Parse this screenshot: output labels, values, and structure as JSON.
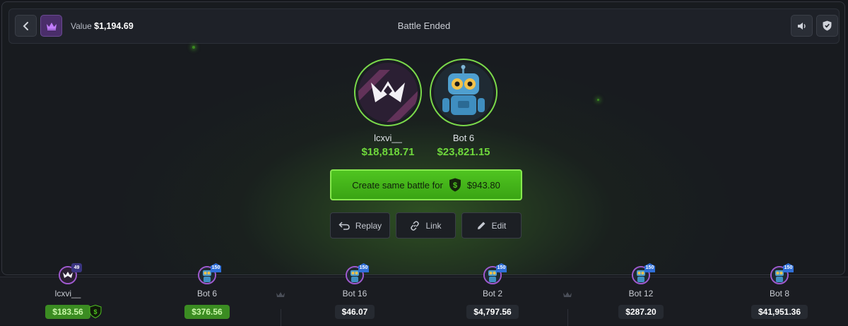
{
  "header": {
    "value_prefix": "Value",
    "value_amount": "$1,194.69",
    "title": "Battle Ended"
  },
  "players": [
    {
      "name": "lcxvi__",
      "total": "$18,818.71",
      "avatar": "logo-avatar"
    },
    {
      "name": "Bot 6",
      "total": "$23,821.15",
      "avatar": "robot-avatar"
    }
  ],
  "actions": {
    "create_label": "Create same battle for",
    "create_price": "$943.80",
    "replay": "Replay",
    "link": "Link",
    "edit": "Edit"
  },
  "slots": [
    {
      "name": "lcxvi__",
      "value": "$183.56",
      "level": "49",
      "win": true,
      "avatar": "logo-avatar"
    },
    {
      "name": "Bot 6",
      "value": "$376.56",
      "level": "150",
      "win": true,
      "avatar": "robot-avatar"
    },
    {
      "name": "Bot 16",
      "value": "$46.07",
      "level": "150",
      "win": false,
      "avatar": "robot-avatar"
    },
    {
      "name": "Bot 2",
      "value": "$4,797.56",
      "level": "150",
      "win": false,
      "avatar": "robot-avatar"
    },
    {
      "name": "Bot 12",
      "value": "$287.20",
      "level": "150",
      "win": false,
      "avatar": "robot-avatar"
    },
    {
      "name": "Bot 8",
      "value": "$41,951.36",
      "level": "150",
      "win": false,
      "avatar": "robot-avatar"
    }
  ],
  "colors": {
    "accent_green": "#6fd83c",
    "button_green": "#4fc420",
    "crown_purple": "#b070ff"
  }
}
